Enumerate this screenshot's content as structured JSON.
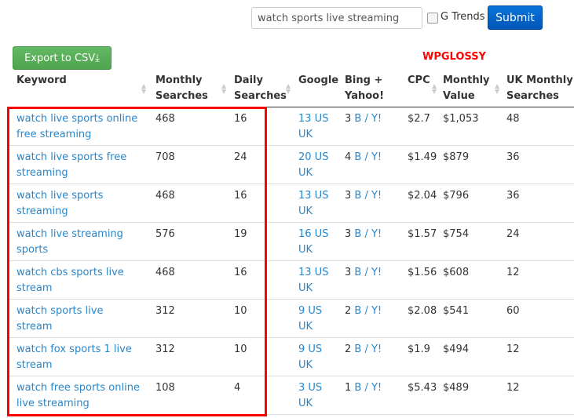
{
  "search": {
    "value": "watch sports live streaming",
    "trends_label": "G Trends",
    "submit_label": "Submit"
  },
  "export_label": "Export to CSV",
  "brand": "WPGLOSSY",
  "headers": {
    "keyword": "Keyword",
    "monthly_1": "Monthly",
    "monthly_2": "Searches",
    "daily_1": "Daily",
    "daily_2": "Searches",
    "google": "Google",
    "bing_1": "Bing +",
    "bing_2": "Yahoo!",
    "cpc": "CPC",
    "value_1": "Monthly",
    "value_2": "Value",
    "uk_1": "UK Monthly",
    "uk_2": "Searches"
  },
  "rows": [
    {
      "keyword": "watch live sports online free streaming",
      "monthly": "468",
      "daily": "16",
      "google": "13 US UK",
      "bing_n": "3",
      "bing": "B / Y!",
      "cpc": "$2.7",
      "value": "$1,053",
      "uk": "48"
    },
    {
      "keyword": "watch live sports free streaming",
      "monthly": "708",
      "daily": "24",
      "google": "20 US UK",
      "bing_n": "4",
      "bing": "B / Y!",
      "cpc": "$1.49",
      "value": "$879",
      "uk": "36"
    },
    {
      "keyword": "watch live sports streaming",
      "monthly": "468",
      "daily": "16",
      "google": "13 US UK",
      "bing_n": "3",
      "bing": "B / Y!",
      "cpc": "$2.04",
      "value": "$796",
      "uk": "36"
    },
    {
      "keyword": "watch live streaming sports",
      "monthly": "576",
      "daily": "19",
      "google": "16 US UK",
      "bing_n": "3",
      "bing": "B / Y!",
      "cpc": "$1.57",
      "value": "$754",
      "uk": "24"
    },
    {
      "keyword": "watch cbs sports live stream",
      "monthly": "468",
      "daily": "16",
      "google": "13 US UK",
      "bing_n": "3",
      "bing": "B / Y!",
      "cpc": "$1.56",
      "value": "$608",
      "uk": "12"
    },
    {
      "keyword": "watch sports live stream",
      "monthly": "312",
      "daily": "10",
      "google": "9 US UK",
      "bing_n": "2",
      "bing": "B / Y!",
      "cpc": "$2.08",
      "value": "$541",
      "uk": "60"
    },
    {
      "keyword": "watch fox sports 1 live stream",
      "monthly": "312",
      "daily": "10",
      "google": "9 US UK",
      "bing_n": "2",
      "bing": "B / Y!",
      "cpc": "$1.9",
      "value": "$494",
      "uk": "12"
    },
    {
      "keyword": "watch free sports online live streaming",
      "monthly": "108",
      "daily": "4",
      "google": "3 US UK",
      "bing_n": "1",
      "bing": "B / Y!",
      "cpc": "$5.43",
      "value": "$489",
      "uk": "12"
    }
  ]
}
